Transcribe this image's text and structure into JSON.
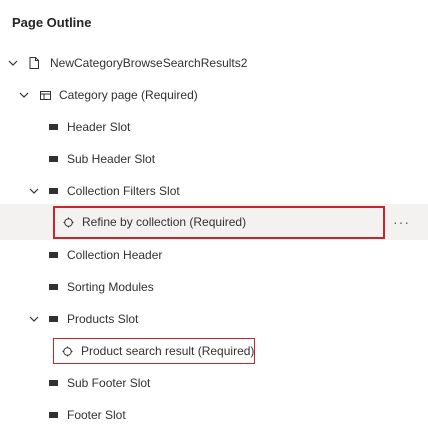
{
  "panel": {
    "title": "Page Outline"
  },
  "tree": {
    "root": "NewCategoryBrowseSearchResults2",
    "category_page": "Category page (Required)",
    "header_slot": "Header Slot",
    "sub_header_slot": "Sub Header Slot",
    "collection_filters_slot": "Collection Filters Slot",
    "refine_by_collection": "Refine by collection (Required)",
    "collection_header": "Collection Header",
    "sorting_modules": "Sorting Modules",
    "products_slot": "Products Slot",
    "product_search_result": "Product search result (Required)",
    "sub_footer_slot": "Sub Footer Slot",
    "footer_slot": "Footer Slot",
    "more_actions": "···"
  },
  "icons": {
    "chevron": "chevron-down-icon",
    "page": "page-icon",
    "template": "layout-icon",
    "slot": "slot-icon",
    "module": "module-icon"
  },
  "colors": {
    "highlight_border": "#c4262e",
    "selected_row": "#f3f2f1"
  }
}
